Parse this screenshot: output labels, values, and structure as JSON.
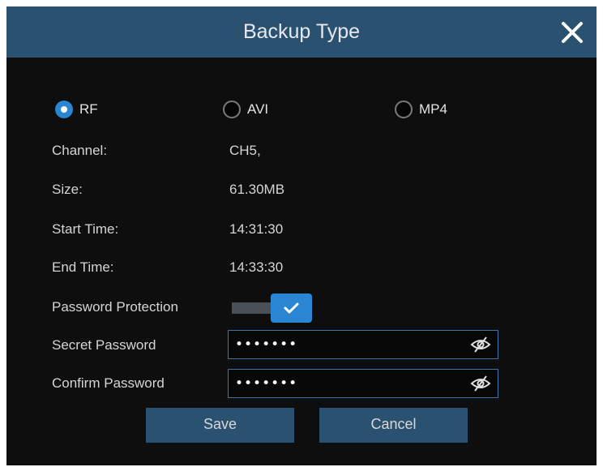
{
  "dialog": {
    "title": "Backup Type"
  },
  "backup_types": [
    {
      "label": "RF",
      "checked": true
    },
    {
      "label": "AVI",
      "checked": false
    },
    {
      "label": "MP4",
      "checked": false
    }
  ],
  "info": {
    "channel_label": "Channel:",
    "channel_value": "CH5,",
    "size_label": "Size:",
    "size_value": "61.30MB",
    "start_label": "Start Time:",
    "start_value": "14:31:30",
    "end_label": "End Time:",
    "end_value": "14:33:30"
  },
  "password_protection": {
    "label": "Password Protection",
    "enabled": true
  },
  "secret_password": {
    "label": "Secret Password",
    "value": "•••••••"
  },
  "confirm_password": {
    "label": "Confirm Password",
    "value": "•••••••"
  },
  "buttons": {
    "save": "Save",
    "cancel": "Cancel"
  },
  "colors": {
    "accent": "#2a86d2",
    "titlebar": "#2b5170",
    "background": "#0e0e0e"
  }
}
